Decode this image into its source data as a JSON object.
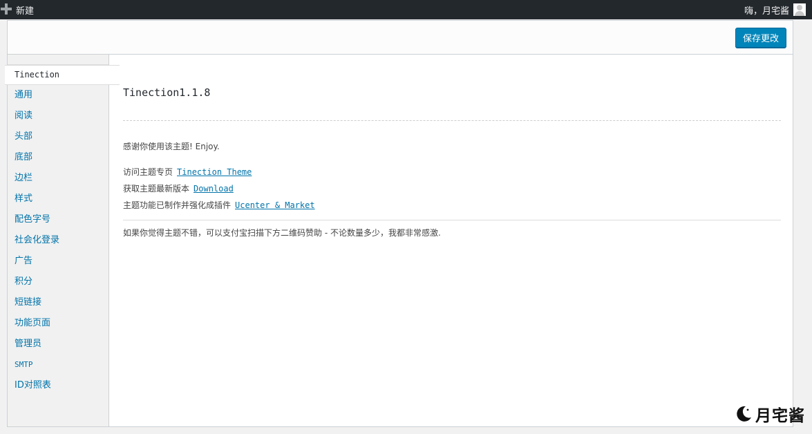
{
  "admin_bar": {
    "new_label": "新建",
    "greeting": "嗨，月宅酱"
  },
  "header": {
    "save_label": "保存更改"
  },
  "sidebar": {
    "items": [
      {
        "label": "Tinection",
        "active": true
      },
      {
        "label": "通用"
      },
      {
        "label": "阅读"
      },
      {
        "label": "头部"
      },
      {
        "label": "底部"
      },
      {
        "label": "边栏"
      },
      {
        "label": "样式"
      },
      {
        "label": "配色字号"
      },
      {
        "label": "社会化登录"
      },
      {
        "label": "广告"
      },
      {
        "label": "积分"
      },
      {
        "label": "短链接"
      },
      {
        "label": "功能页面"
      },
      {
        "label": "管理员"
      },
      {
        "label": "SMTP"
      },
      {
        "label": "ID对照表"
      }
    ]
  },
  "main": {
    "version_title": "Tinection1.1.8",
    "thanks": "感谢你使用该主题! Enjoy.",
    "links": [
      {
        "prefix": "访问主题专页",
        "link": "Tinection Theme"
      },
      {
        "prefix": "获取主题最新版本",
        "link": "Download"
      },
      {
        "prefix": "主题功能已制作并强化成插件",
        "link": "Ucenter & Market"
      }
    ],
    "donate": "如果你觉得主题不错，可以支付宝扫描下方二维码赞助 - 不论数量多少，我都非常感激."
  },
  "watermark": {
    "text": "月宅酱"
  }
}
